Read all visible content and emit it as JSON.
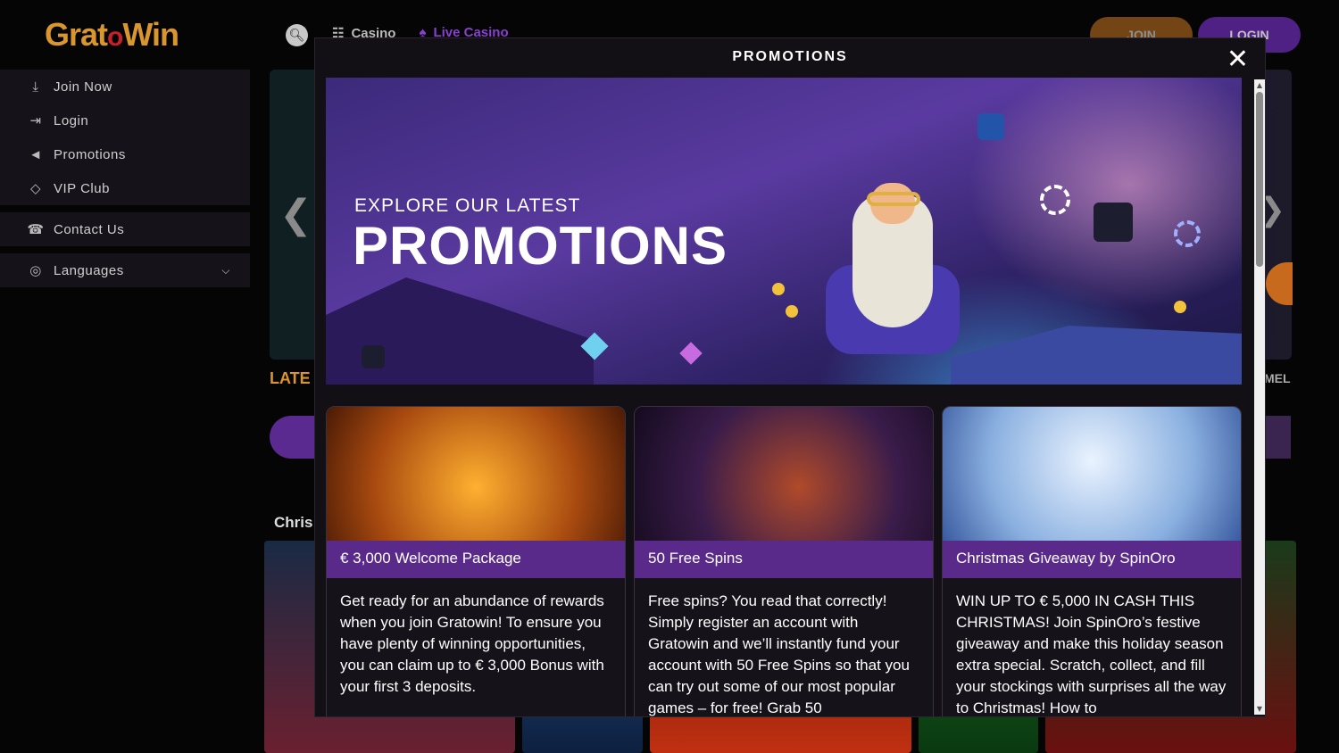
{
  "header": {
    "logo": "GratoWin",
    "nav": [
      {
        "label": "Casino",
        "icon": "slot-machine-icon"
      },
      {
        "label": "Live Casino",
        "icon": "live-dealer-icon"
      }
    ],
    "join_label": "JOIN",
    "login_label": "LOGIN"
  },
  "sidebar": {
    "items": [
      {
        "label": "Join Now",
        "icon": "download-icon"
      },
      {
        "label": "Login",
        "icon": "login-icon"
      },
      {
        "label": "Promotions",
        "icon": "megaphone-icon"
      },
      {
        "label": "VIP Club",
        "icon": "diamond-icon"
      },
      {
        "label": "Contact Us",
        "icon": "phone-icon"
      },
      {
        "label": "Languages",
        "icon": "globe-icon"
      }
    ]
  },
  "background": {
    "latest_label": "LATE",
    "side_label": "MEL",
    "section_label": "Chris"
  },
  "modal": {
    "title": "PROMOTIONS",
    "banner": {
      "kicker": "EXPLORE OUR LATEST",
      "title": "PROMOTIONS"
    },
    "cards": [
      {
        "title": "€ 3,000 Welcome Package",
        "body": "Get ready for an abundance of rewards when you join Gratowin! To ensure you have plenty of winning opportunities, you can claim up to € 3,000 Bonus with your first 3 deposits."
      },
      {
        "title": "50 Free Spins",
        "body": "Free spins? You read that correctly! Simply register an account with Gratowin and we’ll instantly fund your account with 50 Free Spins so that you can try out some of our most popular games – for free! Grab 50"
      },
      {
        "title": "Christmas Giveaway by SpinOro",
        "body": "WIN UP TO € 5,000 IN CASH THIS CHRISTMAS! Join SpinOro’s festive giveaway and make this holiday season extra special. Scratch, collect, and fill your stockings with surprises all the way to Christmas! How to"
      }
    ]
  },
  "colors": {
    "brand_orange": "#d9952e",
    "brand_purple": "#5a2a8a",
    "modal_bg": "#121014"
  }
}
